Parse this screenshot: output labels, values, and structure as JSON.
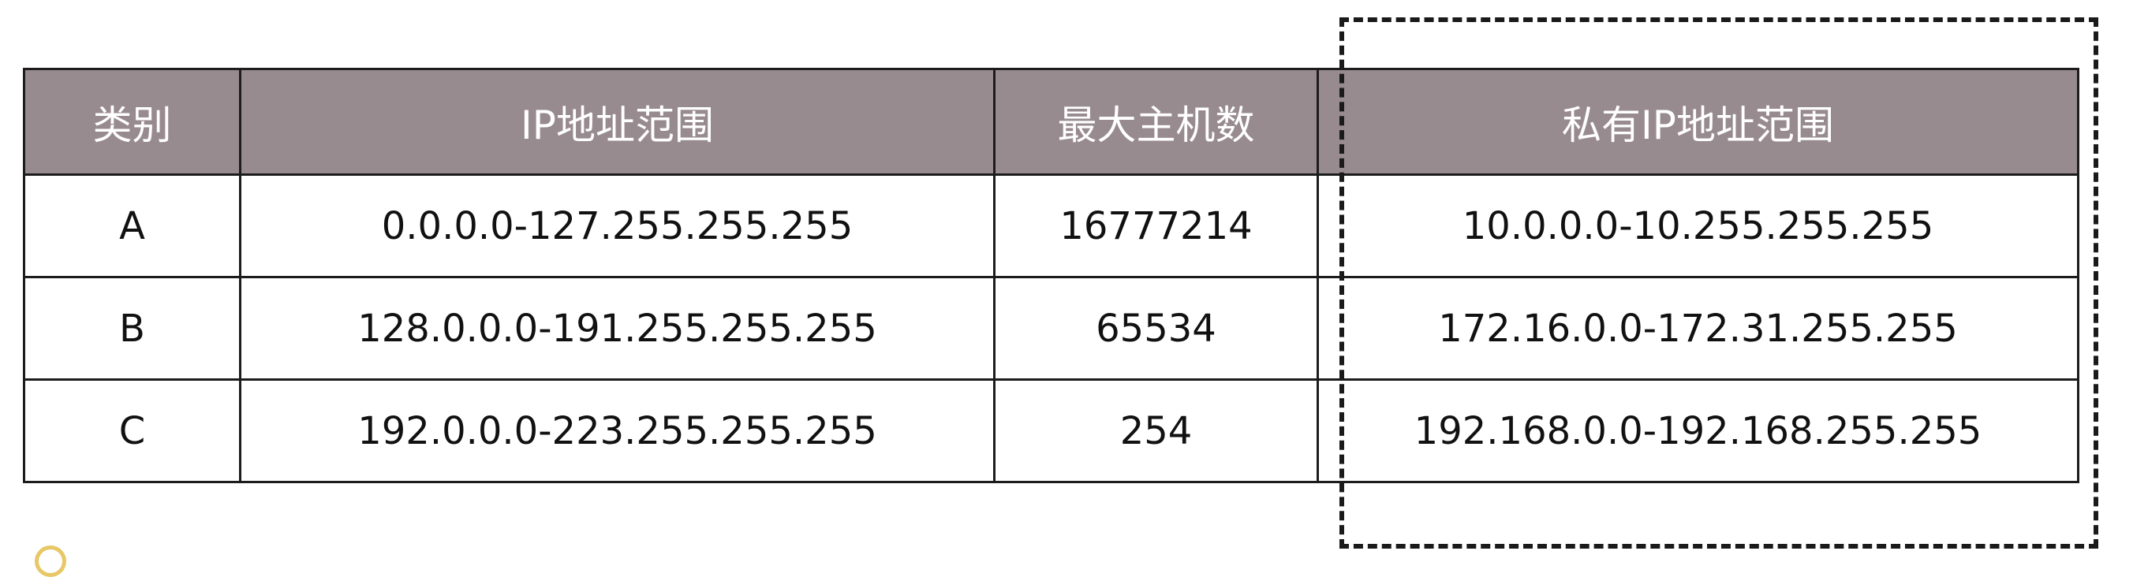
{
  "table": {
    "headers": [
      "类别",
      "IP地址范围",
      "最大主机数",
      "私有IP地址范围"
    ],
    "rows": [
      [
        "A",
        "0.0.0.0-127.255.255.255",
        "16777214",
        "10.0.0.0-10.255.255.255"
      ],
      [
        "B",
        "128.0.0.0-191.255.255.255",
        "65534",
        "172.16.0.0-172.31.255.255"
      ],
      [
        "C",
        "192.0.0.0-223.255.255.255",
        "254",
        "192.168.0.0-192.168.255.255"
      ]
    ]
  },
  "colors": {
    "header_background": "#988b8f",
    "header_text": "#ffffff",
    "border": "#1c1c1c",
    "highlight_border": "#1a1a1a"
  }
}
